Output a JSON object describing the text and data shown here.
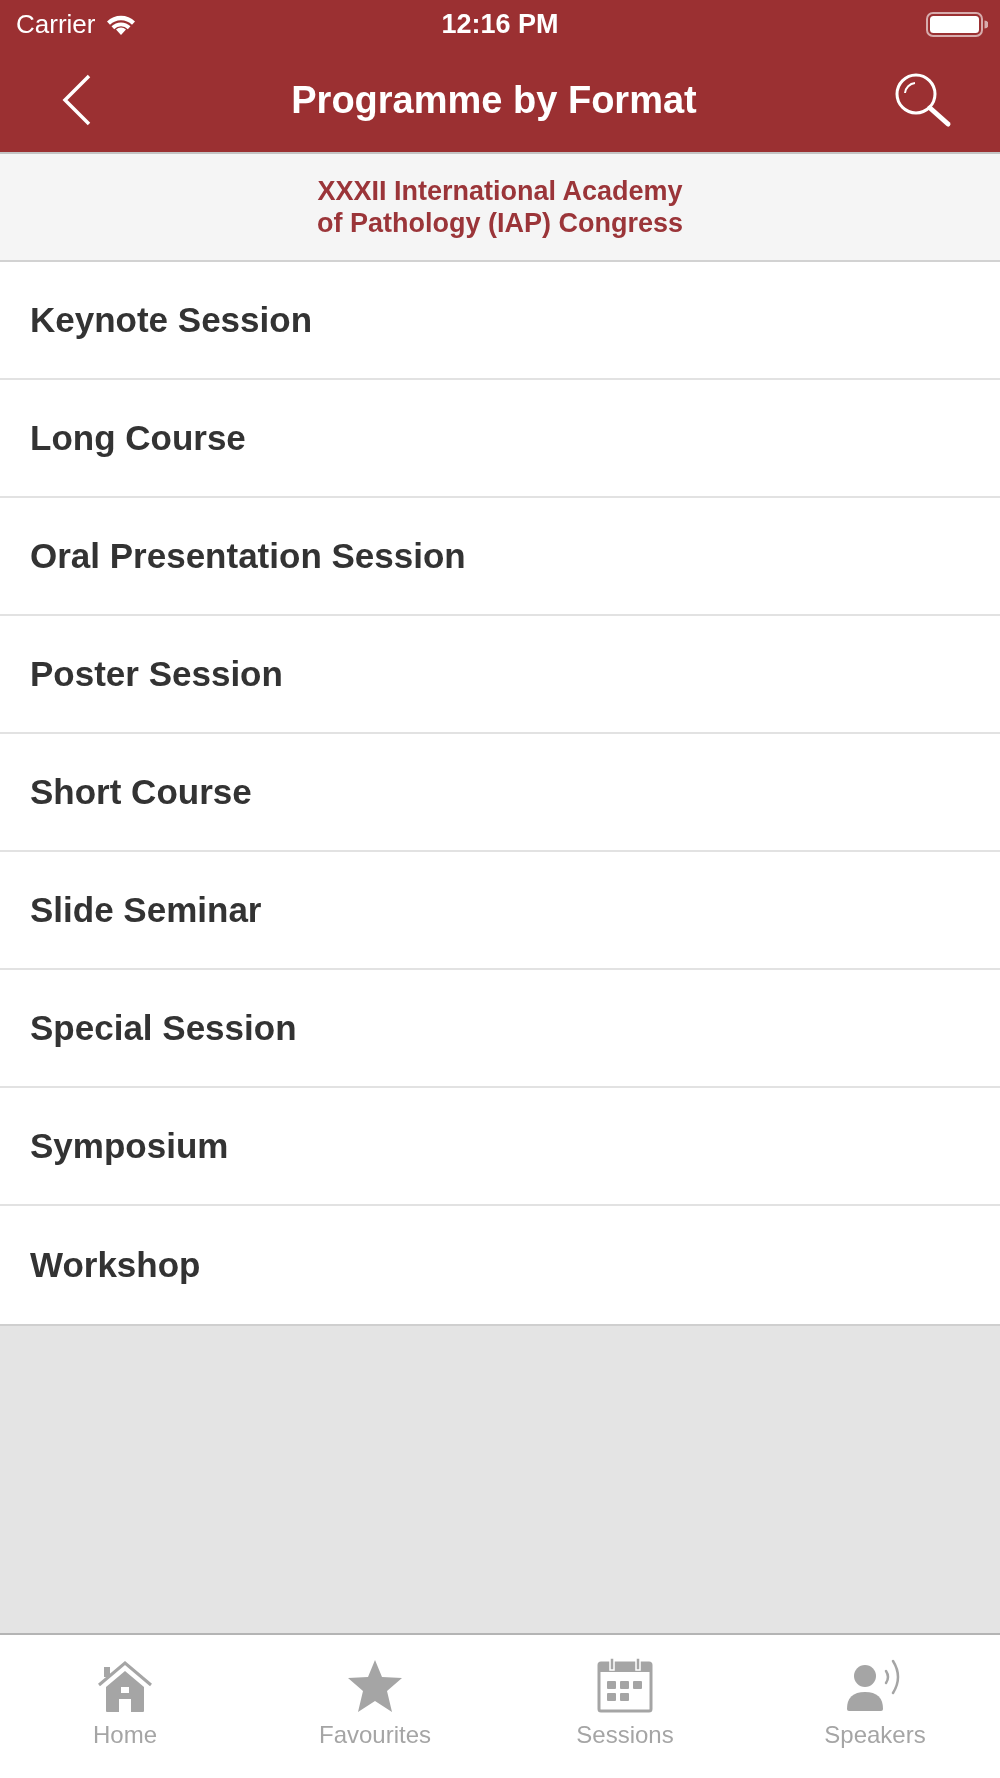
{
  "status_bar": {
    "carrier": "Carrier",
    "time": "12:16 PM"
  },
  "nav_bar": {
    "title": "Programme by Format"
  },
  "banner": {
    "lines": [
      "XXXII International Academy",
      "of Pathology (IAP) Congress"
    ]
  },
  "formats": [
    {
      "label": "Keynote Session"
    },
    {
      "label": "Long Course"
    },
    {
      "label": "Oral Presentation Session"
    },
    {
      "label": "Poster Session"
    },
    {
      "label": "Short Course"
    },
    {
      "label": "Slide Seminar"
    },
    {
      "label": "Special Session"
    },
    {
      "label": "Symposium"
    },
    {
      "label": "Workshop"
    }
  ],
  "tab_bar": {
    "tabs": [
      {
        "label": "Home",
        "kind": "home",
        "selected": false
      },
      {
        "label": "Favourites",
        "kind": "star",
        "selected": false
      },
      {
        "label": "Sessions",
        "kind": "calendar",
        "selected": false
      },
      {
        "label": "Speakers",
        "kind": "speaker",
        "selected": false
      }
    ]
  }
}
